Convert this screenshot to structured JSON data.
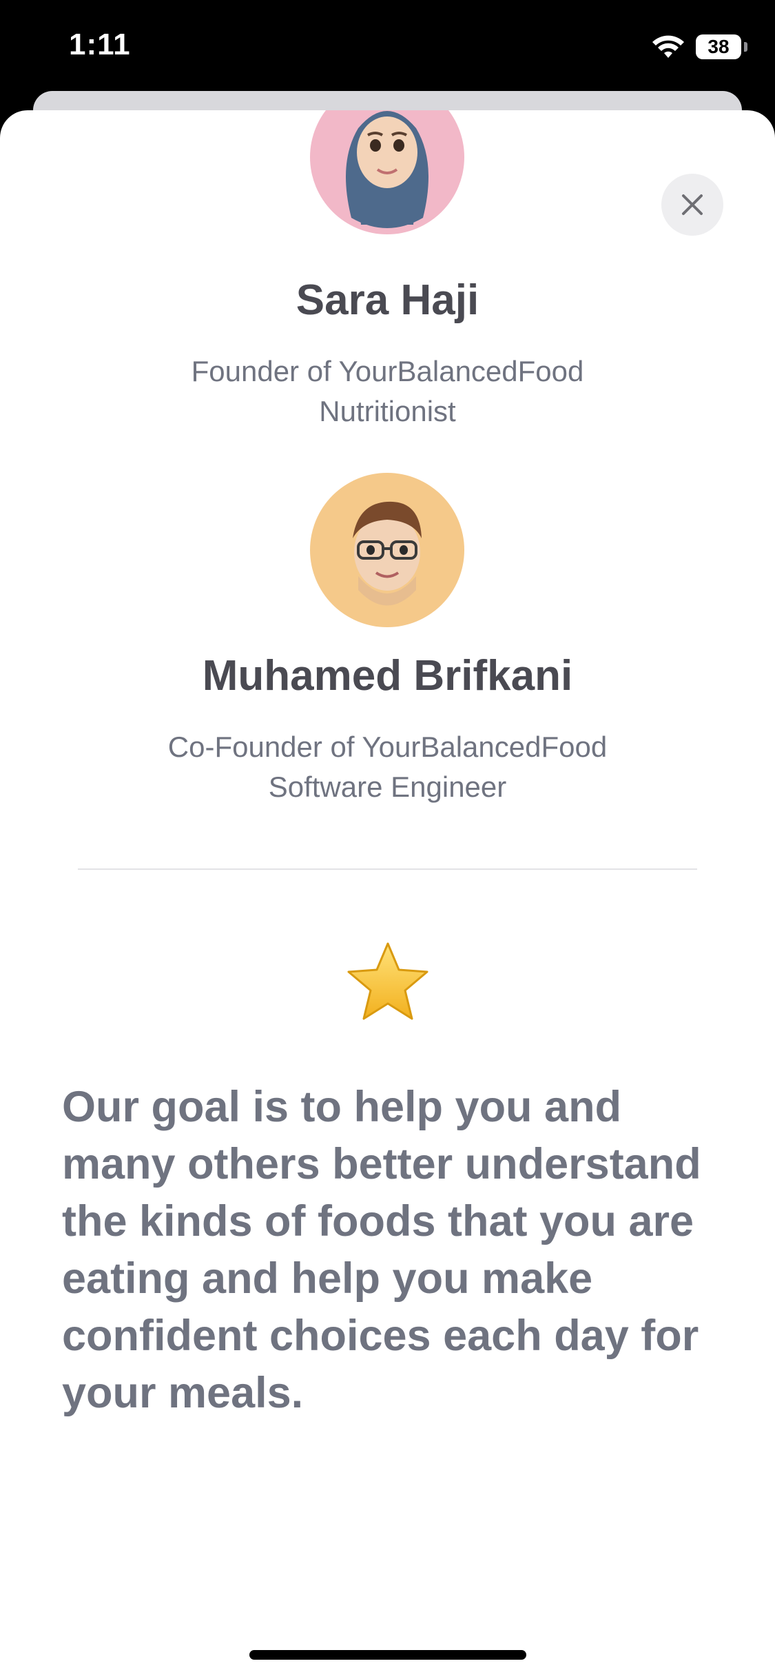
{
  "status_bar": {
    "time": "1:11",
    "battery": "38",
    "wifi_icon": "wifi-icon"
  },
  "close_icon": "xmark-icon",
  "people": [
    {
      "name": "Sara Haji",
      "role_line1": "Founder of YourBalancedFood",
      "role_line2": "Nutritionist",
      "avatar_color": "#f2b8c8"
    },
    {
      "name": "Muhamed Brifkani",
      "role_line1": "Co-Founder of YourBalancedFood",
      "role_line2": "Software Engineer",
      "avatar_color": "#f5c98a"
    }
  ],
  "star_icon": "star-emoji-icon",
  "mission_text": "Our goal is to help you and many others better understand the kinds of foods that you are eating and help you make confident choices each day for your meals.",
  "colors": {
    "name_text": "#4a4a52",
    "secondary_text": "#6f7380",
    "close_button_bg": "#eeeef0"
  }
}
